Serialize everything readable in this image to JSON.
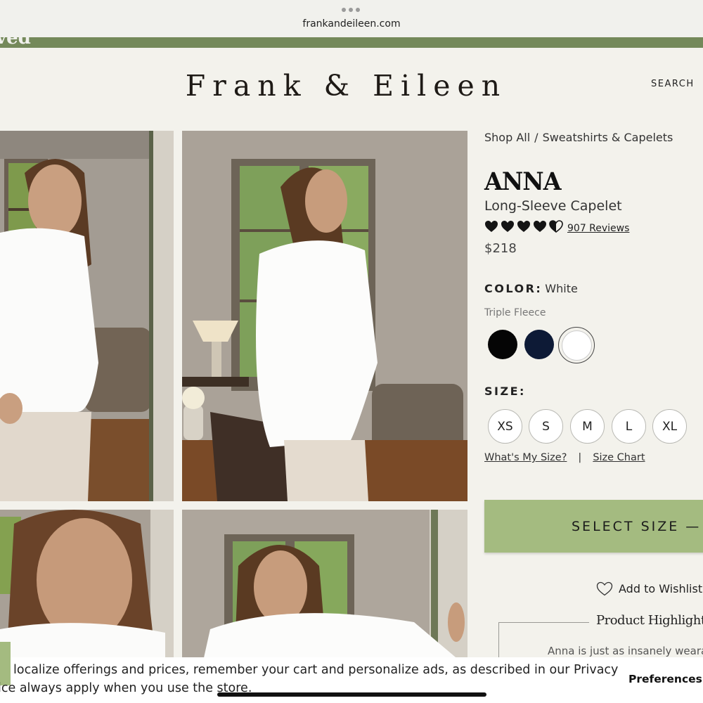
{
  "browser": {
    "url": "frankandeileen.com"
  },
  "header": {
    "logo": "Frank & Eileen",
    "search": "SEARCH"
  },
  "breadcrumb": {
    "items": [
      "Shop All",
      "Sweatshirts & Capelets"
    ],
    "separator": "/"
  },
  "product": {
    "name": "ANNA",
    "subtitle": "Long-Sleeve Capelet",
    "rating": 4.5,
    "rating_max": 5,
    "reviews": "907 Reviews",
    "price": "$218"
  },
  "color": {
    "label": "COLOR:",
    "value": "White",
    "fabric": "Triple Fleece",
    "swatches": [
      {
        "name": "Black",
        "hex": "#050505"
      },
      {
        "name": "Navy",
        "hex": "#0d1a36"
      },
      {
        "name": "White",
        "hex": "#ffffff",
        "selected": true
      }
    ]
  },
  "size": {
    "label": "SIZE:",
    "options": [
      "XS",
      "S",
      "M",
      "L",
      "XL"
    ],
    "whats_my_size": "What's My Size?",
    "divider": "|",
    "size_chart": "Size Chart"
  },
  "cta": {
    "label": "SELECT SIZE — $"
  },
  "wishlist": {
    "label": "Add to Wishlist"
  },
  "highlights": {
    "title": "Product Highlights",
    "text": "Anna is just as insanely weara"
  },
  "cookie": {
    "line1": "localize offerings and prices, remember your cart and personalize ads, as described in our Privacy",
    "line2": "ice always apply when you use the store.",
    "preferences": "Preferences"
  },
  "colors": {
    "accent_green": "#a4bb80",
    "promo_green": "#74895a",
    "background": "#f3f2ec"
  }
}
